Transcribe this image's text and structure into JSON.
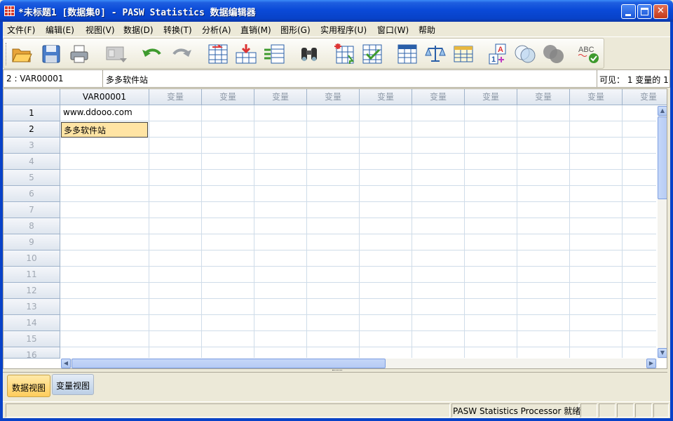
{
  "window": {
    "title": "*未标题1 [数据集0] - PASW Statistics 数据编辑器",
    "minimize": "",
    "maximize": "",
    "close": "✕"
  },
  "menu": [
    "文件(F)",
    "编辑(E)",
    "视图(V)",
    "数据(D)",
    "转换(T)",
    "分析(A)",
    "直销(M)",
    "图形(G)",
    "实用程序(U)",
    "窗口(W)",
    "帮助"
  ],
  "toolbar": {
    "icons": [
      "open-folder-icon",
      "save-disk-icon",
      "print-icon",
      "dialog-recall-icon",
      "undo-icon",
      "redo-icon",
      "goto-case-icon",
      "goto-variable-icon",
      "variables-icon",
      "find-binoculars-icon",
      "insert-cases-icon",
      "split-file-icon",
      "select-cases-icon",
      "weight-cases-icon",
      "value-labels-icon",
      "use-sets-icon",
      "show-all-variables-icon",
      "spell-check-icon"
    ],
    "spell_label": "ABC"
  },
  "editbar": {
    "cell_ref": "2 : VAR00001",
    "cell_value": "多多软件站",
    "visible_info": "可见： 1 变量的 1"
  },
  "grid": {
    "columns": [
      "VAR00001",
      "变量",
      "变量",
      "变量",
      "变量",
      "变量",
      "变量",
      "变量",
      "变量",
      "变量",
      "变量"
    ],
    "rows": [
      "1",
      "2",
      "3",
      "4",
      "5",
      "6",
      "7",
      "8",
      "9",
      "10",
      "11",
      "12",
      "13",
      "14",
      "15",
      "16"
    ],
    "cells": [
      "www.ddooo.com",
      "多多软件站"
    ],
    "scroll_up": "▲",
    "scroll_down": "▼",
    "scroll_left": "◀",
    "scroll_right": "▶"
  },
  "tabs": {
    "data_view": "数据视图",
    "variable_view": "变量视图"
  },
  "status": {
    "processor": "PASW Statistics Processor 就绪"
  },
  "colors": {
    "titlebar": "#0a4ad8",
    "selected_cell": "#ffe4a4",
    "active_tab": "#ffcd5c",
    "grid_line": "#cfdce9"
  }
}
